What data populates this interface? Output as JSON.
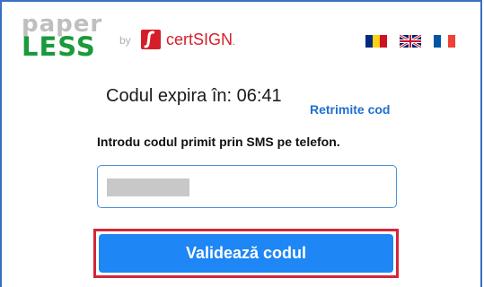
{
  "brand": {
    "logo_top": "paper",
    "logo_bottom": "LESS",
    "by_text": "by",
    "partner_name": "certSIGN",
    "partner_mark": "."
  },
  "languages": [
    {
      "code": "ro",
      "icon": "flag-romania-icon"
    },
    {
      "code": "en",
      "icon": "flag-uk-icon"
    },
    {
      "code": "fr",
      "icon": "flag-france-icon"
    }
  ],
  "verification": {
    "timer_text": "Codul expira în: 06:41",
    "resend_label": "Retrimite cod",
    "instruction": "Introdu codul primit prin SMS pe telefon.",
    "code_value": "",
    "submit_label": "Validează codul"
  },
  "colors": {
    "paper_gray": "#bfbfbf",
    "less_green": "#1a9a3c",
    "certsign_red": "#d41f2b",
    "link_blue": "#1f6fd0",
    "button_blue": "#1e86f5",
    "highlight_red": "#d3263a"
  }
}
